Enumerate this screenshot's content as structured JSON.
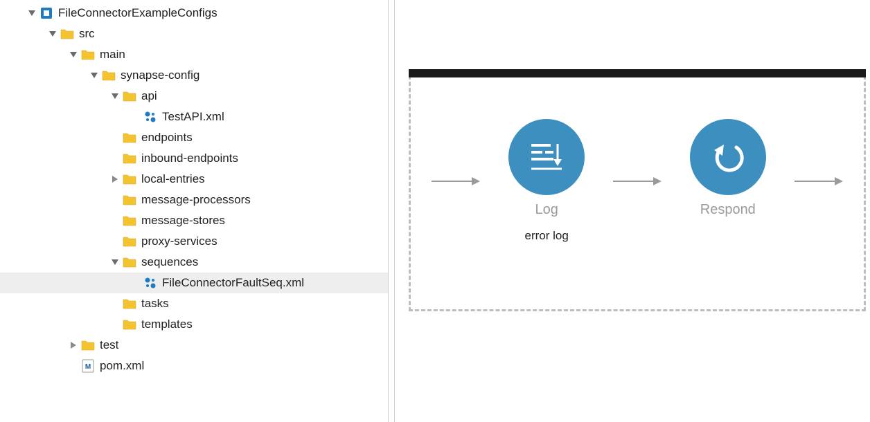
{
  "tree": {
    "root": "FileConnectorExampleConfigs",
    "src": "src",
    "main": "main",
    "synapse_config": "synapse-config",
    "api": "api",
    "test_api": "TestAPI.xml",
    "endpoints": "endpoints",
    "inbound_endpoints": "inbound-endpoints",
    "local_entries": "local-entries",
    "message_processors": "message-processors",
    "message_stores": "message-stores",
    "proxy_services": "proxy-services",
    "sequences": "sequences",
    "fault_seq": "FileConnectorFaultSeq.xml",
    "tasks": "tasks",
    "templates": "templates",
    "test": "test",
    "pom": "pom.xml"
  },
  "diagram": {
    "node1_label": "Log",
    "node1_sub": "error log",
    "node2_label": "Respond"
  }
}
